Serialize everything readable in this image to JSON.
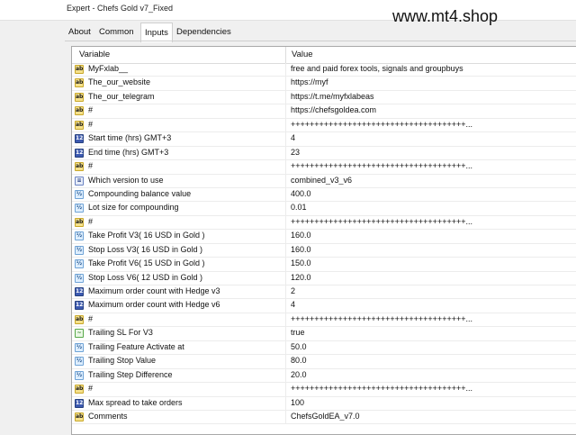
{
  "window": {
    "title": "Expert - Chefs Gold v7_Fixed",
    "watermark": "www.mt4.shop"
  },
  "tabs": [
    {
      "label": "About",
      "active": false
    },
    {
      "label": "Common",
      "active": false
    },
    {
      "label": "Inputs",
      "active": true
    },
    {
      "label": "Dependencies",
      "active": false
    }
  ],
  "table": {
    "headers": {
      "variable": "Variable",
      "value": "Value"
    },
    "rows": [
      {
        "icon": "ab",
        "variable": "MyFxlab__",
        "value": "free and paid forex tools, signals and groupbuys"
      },
      {
        "icon": "ab",
        "variable": "The_our_website",
        "value": "https://myf"
      },
      {
        "icon": "ab",
        "variable": "The_our_telegram",
        "value": "https://t.me/myfxlabeas"
      },
      {
        "icon": "ab",
        "variable": "#",
        "value": "https://chefsgoldea.com"
      },
      {
        "icon": "ab",
        "variable": "#",
        "value": "+++++++++++++++++++++++++++++++++++++..."
      },
      {
        "icon": "123",
        "variable": "Start time (hrs) GMT+3",
        "value": "4"
      },
      {
        "icon": "123",
        "variable": "End time (hrs) GMT+3",
        "value": "23"
      },
      {
        "icon": "ab",
        "variable": "#",
        "value": "+++++++++++++++++++++++++++++++++++++..."
      },
      {
        "icon": "enum",
        "variable": "Which version to use",
        "value": "combined_v3_v6"
      },
      {
        "icon": "v2",
        "variable": "Compounding balance value",
        "value": "400.0"
      },
      {
        "icon": "v2",
        "variable": "Lot size for compounding",
        "value": "0.01"
      },
      {
        "icon": "ab",
        "variable": "#",
        "value": "+++++++++++++++++++++++++++++++++++++..."
      },
      {
        "icon": "v2",
        "variable": "Take Profit V3( 16 USD in Gold )",
        "value": "160.0"
      },
      {
        "icon": "v2",
        "variable": "Stop Loss V3( 16 USD in Gold )",
        "value": "160.0"
      },
      {
        "icon": "v2",
        "variable": "Take Profit V6( 15 USD in Gold )",
        "value": "150.0"
      },
      {
        "icon": "v2",
        "variable": "Stop Loss V6( 12 USD in Gold )",
        "value": "120.0"
      },
      {
        "icon": "123",
        "variable": "Maximum order count with Hedge v3",
        "value": "2"
      },
      {
        "icon": "123",
        "variable": "Maximum order count with Hedge v6",
        "value": "4"
      },
      {
        "icon": "ab",
        "variable": "#",
        "value": "+++++++++++++++++++++++++++++++++++++..."
      },
      {
        "icon": "bool",
        "variable": "Trailing SL For V3",
        "value": "true"
      },
      {
        "icon": "v2",
        "variable": "Trailing Feature Activate at",
        "value": "50.0"
      },
      {
        "icon": "v2",
        "variable": "Trailing Stop Value",
        "value": "80.0"
      },
      {
        "icon": "v2",
        "variable": "Trailing Step Difference",
        "value": "20.0"
      },
      {
        "icon": "ab",
        "variable": "#",
        "value": "+++++++++++++++++++++++++++++++++++++..."
      },
      {
        "icon": "123",
        "variable": "Max spread to take orders",
        "value": "100"
      },
      {
        "icon": "ab",
        "variable": "Comments",
        "value": "ChefsGoldEA_v7.0"
      }
    ]
  }
}
